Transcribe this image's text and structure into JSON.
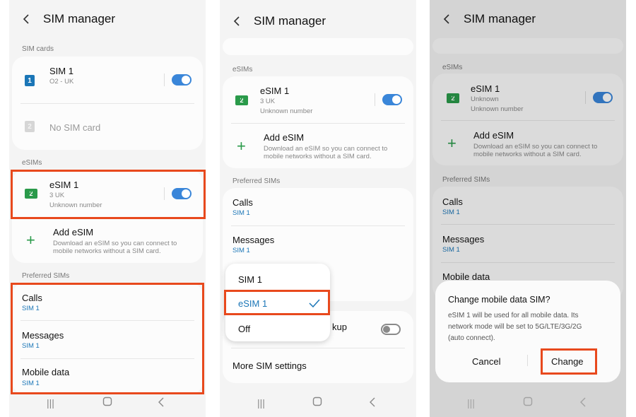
{
  "panels": [
    {
      "title": "SIM manager",
      "sections": {
        "sim_cards": "SIM cards",
        "esims": "eSIMs",
        "preferred": "Preferred SIMs"
      },
      "sim1": {
        "name": "SIM 1",
        "carrier": "O2 - UK",
        "badge": "1"
      },
      "no_sim": {
        "label": "No SIM card",
        "badge": "2"
      },
      "esim": {
        "name": "eSIM 1",
        "carrier": "3 UK",
        "number": "Unknown number",
        "badge": "2"
      },
      "add_esim": {
        "title": "Add eSIM",
        "desc_l1": "Download an eSIM so you can connect to",
        "desc_l2": "mobile networks without a SIM card."
      },
      "preferred": [
        {
          "label": "Calls",
          "value": "SIM 1"
        },
        {
          "label": "Messages",
          "value": "SIM 1"
        },
        {
          "label": "Mobile data",
          "value": "SIM 1"
        }
      ]
    },
    {
      "title": "SIM manager",
      "sections": {
        "esims": "eSIMs",
        "preferred": "Preferred SIMs"
      },
      "esim": {
        "name": "eSIM 1",
        "carrier": "3 UK",
        "number": "Unknown number",
        "badge": "2"
      },
      "add_esim": {
        "title": "Add eSIM",
        "desc_l1": "Download an eSIM so you can connect to",
        "desc_l2": "mobile networks without a SIM card."
      },
      "preferred": [
        {
          "label": "Calls",
          "value": "SIM 1"
        },
        {
          "label": "Messages",
          "value": "SIM 1"
        }
      ],
      "backup_label_fragment": "kup",
      "more_settings": "More SIM settings",
      "popup_options": [
        "SIM 1",
        "eSIM 1",
        "Off"
      ],
      "popup_selected": "eSIM 1"
    },
    {
      "title": "SIM manager",
      "sections": {
        "esims": "eSIMs",
        "preferred": "Preferred SIMs"
      },
      "esim": {
        "name": "eSIM 1",
        "carrier": "Unknown",
        "number": "Unknown number",
        "badge": "2"
      },
      "add_esim": {
        "title": "Add eSIM",
        "desc_l1": "Download an eSIM so you can connect to",
        "desc_l2": "mobile networks without a SIM card."
      },
      "preferred": [
        {
          "label": "Calls",
          "value": "SIM 1"
        },
        {
          "label": "Messages",
          "value": "SIM 1"
        },
        {
          "label": "Mobile data"
        }
      ],
      "dialog": {
        "title": "Change mobile data SIM?",
        "body_l1": "eSIM 1 will be used for all mobile data. Its",
        "body_l2": "network mode will be set to 5G/LTE/3G/2G",
        "body_l3": "(auto connect).",
        "cancel": "Cancel",
        "confirm": "Change"
      }
    }
  ],
  "colors": {
    "accent_blue": "#3a86d9",
    "highlight": "#e8491d",
    "esim_green": "#2a9a4a"
  },
  "icons": {
    "back": "chevron-left-icon",
    "recents": "recent-apps-icon",
    "home": "home-icon",
    "nav_back": "nav-back-icon"
  }
}
